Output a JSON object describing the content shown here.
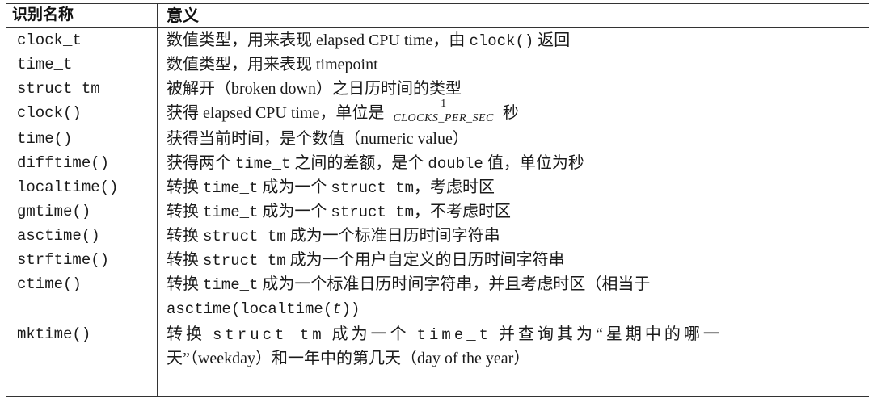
{
  "header": {
    "col1": "识别名称",
    "col2": "意义"
  },
  "rows": [
    {
      "name": "clock_t",
      "desc": {
        "a": "数值类型，用来表现 elapsed CPU time，由 ",
        "code": "clock()",
        "b": " 返回"
      }
    },
    {
      "name": "time_t",
      "desc": {
        "a": "数值类型，用来表现 timepoint"
      }
    },
    {
      "name": "struct tm",
      "desc": {
        "a": "被解开（broken down）之日历时间的类型"
      }
    },
    {
      "name": "clock()",
      "desc": {
        "a": "获得 elapsed CPU time，单位是 ",
        "frac_num": "1",
        "frac_den": "CLOCKS_PER_SEC",
        "b": " 秒"
      }
    },
    {
      "name": "time()",
      "desc": {
        "a": "获得当前时间，是个数值（numeric value）"
      }
    },
    {
      "name": "difftime()",
      "desc": {
        "a": "获得两个 ",
        "code": "time_t",
        "b": " 之间的差额，是个 ",
        "code2": "double",
        "c": " 值，单位为秒"
      }
    },
    {
      "name": "localtime()",
      "desc": {
        "a": "转换 ",
        "code": "time_t",
        "b": " 成为一个 ",
        "code2": "struct tm",
        "c": "，考虑时区"
      }
    },
    {
      "name": "gmtime()",
      "desc": {
        "a": "转换 ",
        "code": "time_t",
        "b": " 成为一个 ",
        "code2": "struct tm",
        "c": "，不考虑时区"
      }
    },
    {
      "name": "asctime()",
      "desc": {
        "a": "转换 ",
        "code": "struct tm",
        "b": " 成为一个标准日历时间字符串"
      }
    },
    {
      "name": "strftime()",
      "desc": {
        "a": "转换 ",
        "code": "struct tm",
        "b": " 成为一个用户自定义的日历时间字符串"
      }
    },
    {
      "name": "ctime()",
      "desc": {
        "a": "转换 ",
        "code": "time_t",
        "b": " 成为一个标准日历时间字符串，并且考虑时区（相当于",
        "line2_code": "asctime(localtime(",
        "line2_italic": "t",
        "line2_end": "))"
      }
    },
    {
      "name": "mktime()",
      "desc": {
        "a": "转换 ",
        "code": "struct tm",
        "b": " 成为一个 ",
        "code2": "time_t",
        "c": " 并查询其为“星期中的哪一",
        "line2": "天”（weekday）和一年中的第几天（day of the year）"
      }
    }
  ]
}
